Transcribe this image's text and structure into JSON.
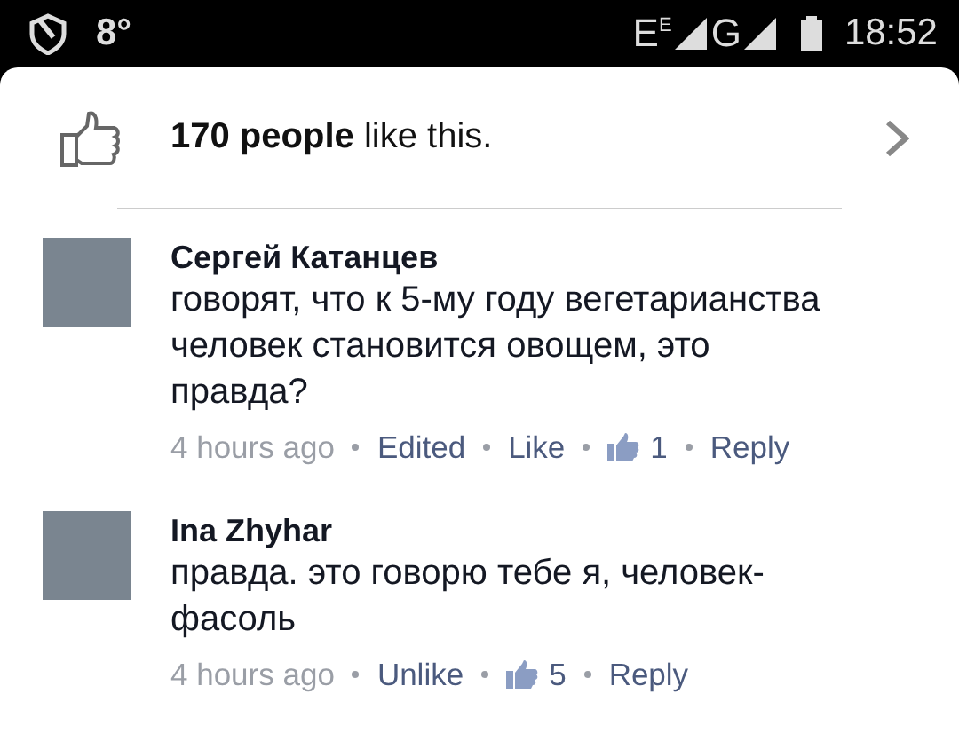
{
  "status_bar": {
    "temperature": "8°",
    "network_1": "E",
    "network_1_sup": "E",
    "network_2": "G",
    "time": "18:52"
  },
  "likes_summary": {
    "text": "**170 people** like this."
  },
  "comments": [
    {
      "author": "Сергей Катанцев",
      "text": "говорят, что к 5-му году вегетарианства человек становится овощем, это правда?",
      "time": "4 hours ago",
      "edited": "Edited",
      "action": "Like",
      "likes": "1",
      "reply": "Reply"
    },
    {
      "author": "Ina Zhyhar",
      "text": "правда. это говорю тебе я, человек-фасоль",
      "time": "4 hours ago",
      "action": "Unlike",
      "likes": "5",
      "reply": "Reply"
    }
  ]
}
